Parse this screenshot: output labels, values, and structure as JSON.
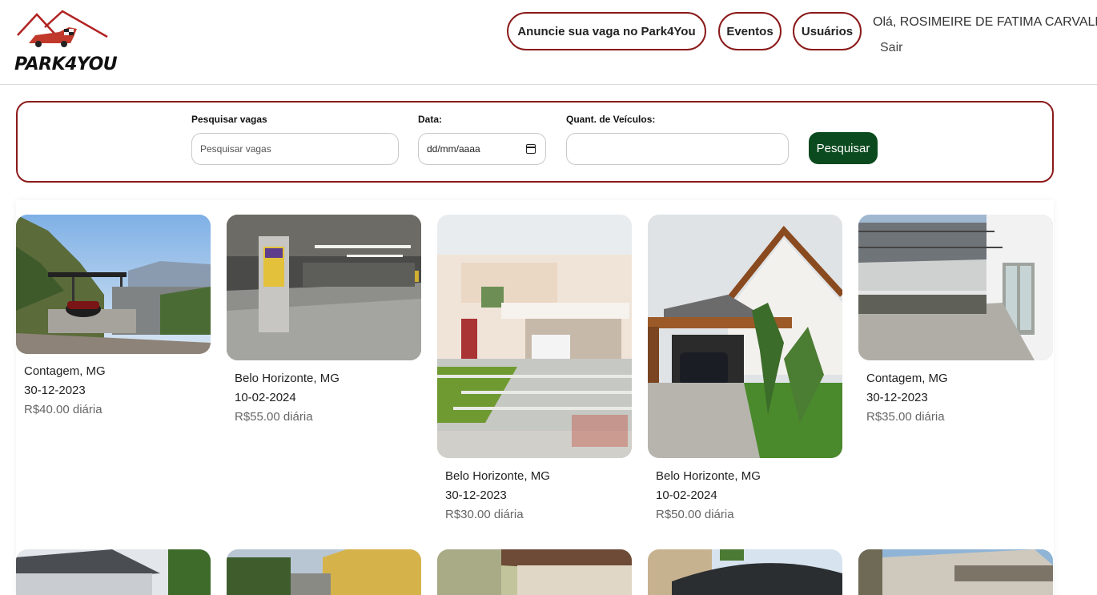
{
  "brand": {
    "name": "PARK4YOU"
  },
  "nav": {
    "anuncie": "Anuncie sua vaga no Park4You",
    "eventos": "Eventos",
    "usuarios": "Usuários",
    "greeting": "Olá, ROSIMEIRE DE FATIMA CARVALHO",
    "logout": "Sair"
  },
  "search": {
    "query_label": "Pesquisar vagas",
    "query_placeholder": "Pesquisar vagas",
    "date_label": "Data:",
    "date_placeholder": "dd/mm/aaaa",
    "vehicles_label": "Quant. de Veículos:",
    "vehicles_value": "",
    "button_label": "Pesquisar"
  },
  "listings": [
    {
      "city": "Contagem, MG",
      "date": "30-12-2023",
      "price": "R$40.00 diária"
    },
    {
      "city": "Belo Horizonte, MG",
      "date": "10-02-2024",
      "price": "R$55.00 diária"
    },
    {
      "city": "Belo Horizonte, MG",
      "date": "30-12-2023",
      "price": "R$30.00 diária"
    },
    {
      "city": "Belo Horizonte, MG",
      "date": "10-02-2024",
      "price": "R$50.00 diária"
    },
    {
      "city": "Contagem, MG",
      "date": "30-12-2023",
      "price": "R$35.00 diária"
    }
  ],
  "colors": {
    "accent": "#8b1a1a",
    "button": "#0b4a1e"
  }
}
